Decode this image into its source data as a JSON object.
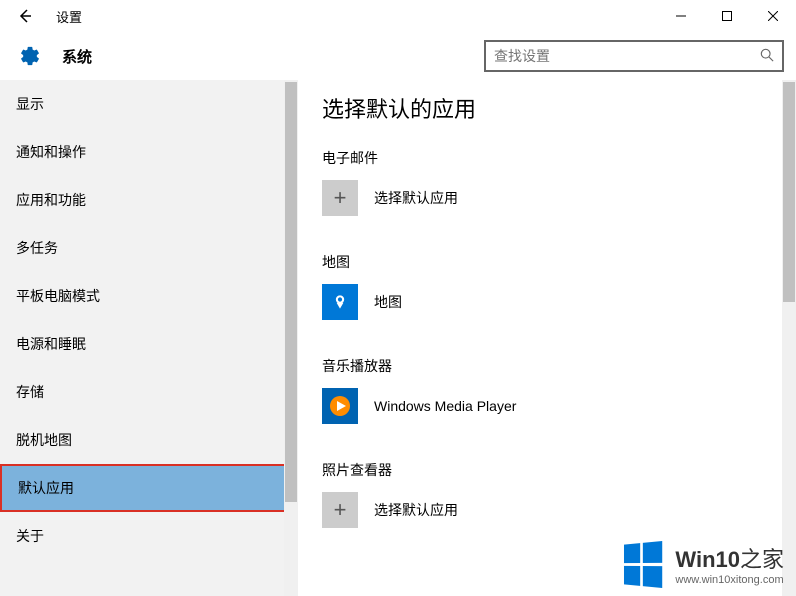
{
  "titlebar": {
    "title": "设置"
  },
  "header": {
    "section": "系统",
    "search_placeholder": "查找设置"
  },
  "sidebar": {
    "items": [
      {
        "label": "显示"
      },
      {
        "label": "通知和操作"
      },
      {
        "label": "应用和功能"
      },
      {
        "label": "多任务"
      },
      {
        "label": "平板电脑模式"
      },
      {
        "label": "电源和睡眠"
      },
      {
        "label": "存储"
      },
      {
        "label": "脱机地图"
      },
      {
        "label": "默认应用"
      },
      {
        "label": "关于"
      }
    ]
  },
  "content": {
    "title": "选择默认的应用",
    "sections": [
      {
        "label": "电子邮件",
        "app": "选择默认应用",
        "type": "add"
      },
      {
        "label": "地图",
        "app": "地图",
        "type": "maps"
      },
      {
        "label": "音乐播放器",
        "app": "Windows Media Player",
        "type": "wmp"
      },
      {
        "label": "照片查看器",
        "app": "选择默认应用",
        "type": "add"
      }
    ]
  },
  "watermark": {
    "brand_prefix": "Win10",
    "brand_suffix": "之家",
    "url": "www.win10xitong.com"
  }
}
